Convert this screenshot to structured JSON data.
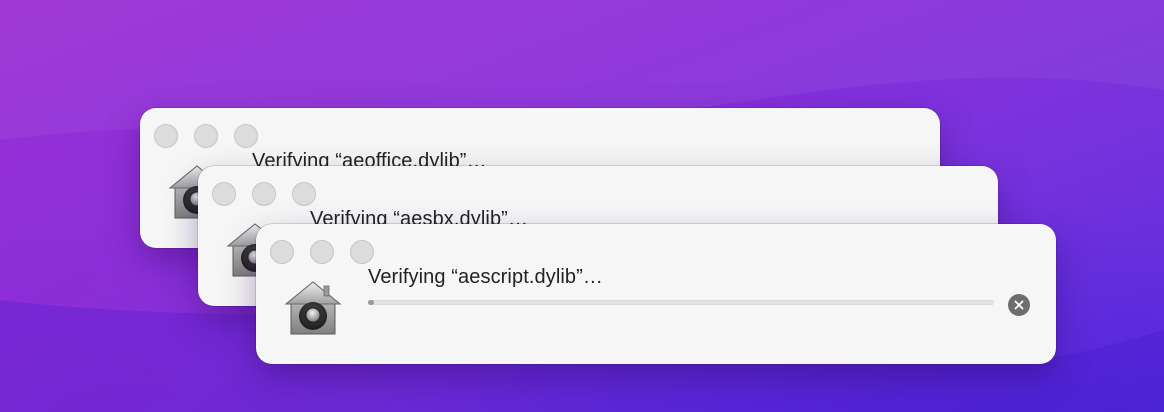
{
  "colors": {
    "accent_gradient": [
      "#9a2fd4",
      "#5a2ee0"
    ],
    "dialog_background": "#f6f6f6",
    "traffic_light": "#dcdcdc",
    "progress_fill": "#9a9a9a",
    "cancel_button": "#6e6e6e"
  },
  "dialogs": [
    {
      "title": "Verifying “aeoffice.dylib”…",
      "icon": "gatekeeper-house-lock-icon",
      "progress": 0.01
    },
    {
      "title": "Verifying “aesbx.dylib”…",
      "icon": "gatekeeper-house-lock-icon",
      "progress": 0.01
    },
    {
      "title": "Verifying “aescript.dylib”…",
      "icon": "gatekeeper-house-lock-icon",
      "progress": 0.01,
      "cancel_icon": "close-icon"
    }
  ]
}
